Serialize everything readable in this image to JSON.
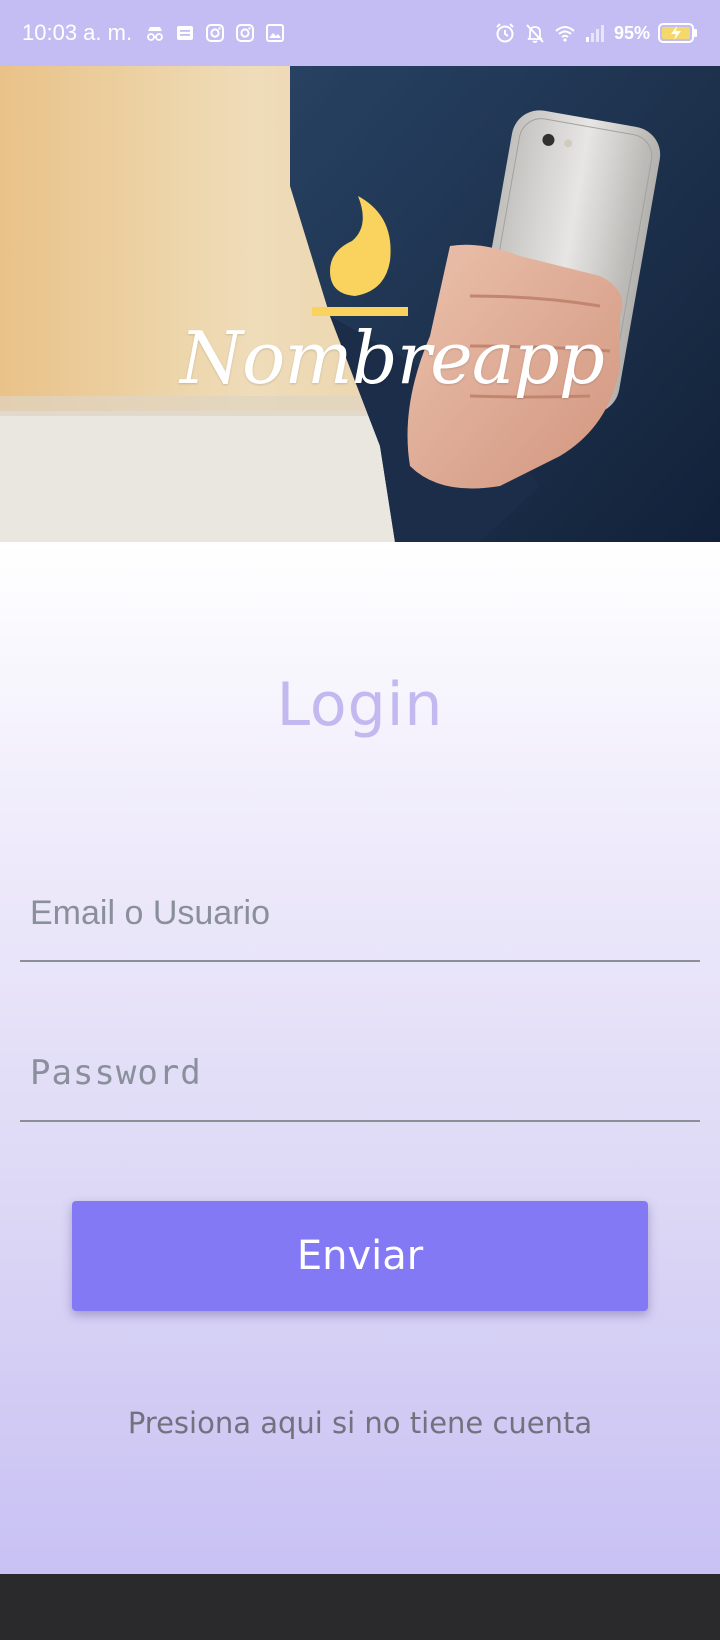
{
  "status_bar": {
    "time": "10:03 a. m.",
    "battery_percent": "95%",
    "left_icons": [
      "incognito-icon",
      "news-icon",
      "instagram-icon",
      "instagram-icon",
      "gallery-icon"
    ],
    "right_icons": [
      "alarm-icon",
      "mute-bell-icon",
      "wifi-icon",
      "signal-icon",
      "battery-charging-icon"
    ],
    "background_color": "#c4bdf3"
  },
  "hero": {
    "logo_text": "Nombreapp",
    "logo_icon": "flame-icon",
    "logo_color": "#f9d35e"
  },
  "login": {
    "title": "Login",
    "email_placeholder": "Email o Usuario",
    "password_placeholder": "Password",
    "submit_label": "Enviar",
    "register_link": "Presiona aqui si no tiene cuenta",
    "accent_color": "#8479f5"
  }
}
